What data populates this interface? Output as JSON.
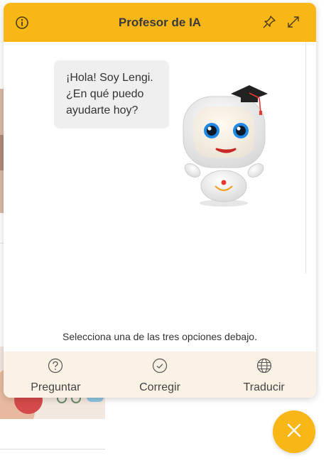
{
  "header": {
    "title": "Profesor de IA",
    "icons": [
      "info-icon",
      "pin-icon",
      "expand-icon"
    ]
  },
  "chat": {
    "message": "¡Hola! Soy Lengi.\n¿En qué puedo\nayudarte hoy?"
  },
  "instruction": "Selecciona una de las tres opciones debajo.",
  "options": [
    {
      "label": "Preguntar",
      "icon": "question-icon"
    },
    {
      "label": "Corregir",
      "icon": "check-icon"
    },
    {
      "label": "Traducir",
      "icon": "globe-icon"
    }
  ],
  "fab": {
    "icon": "close-icon"
  },
  "colors": {
    "accent": "#f9b717",
    "options_bg": "#fbf1e4",
    "bubble_bg": "#efefef"
  }
}
